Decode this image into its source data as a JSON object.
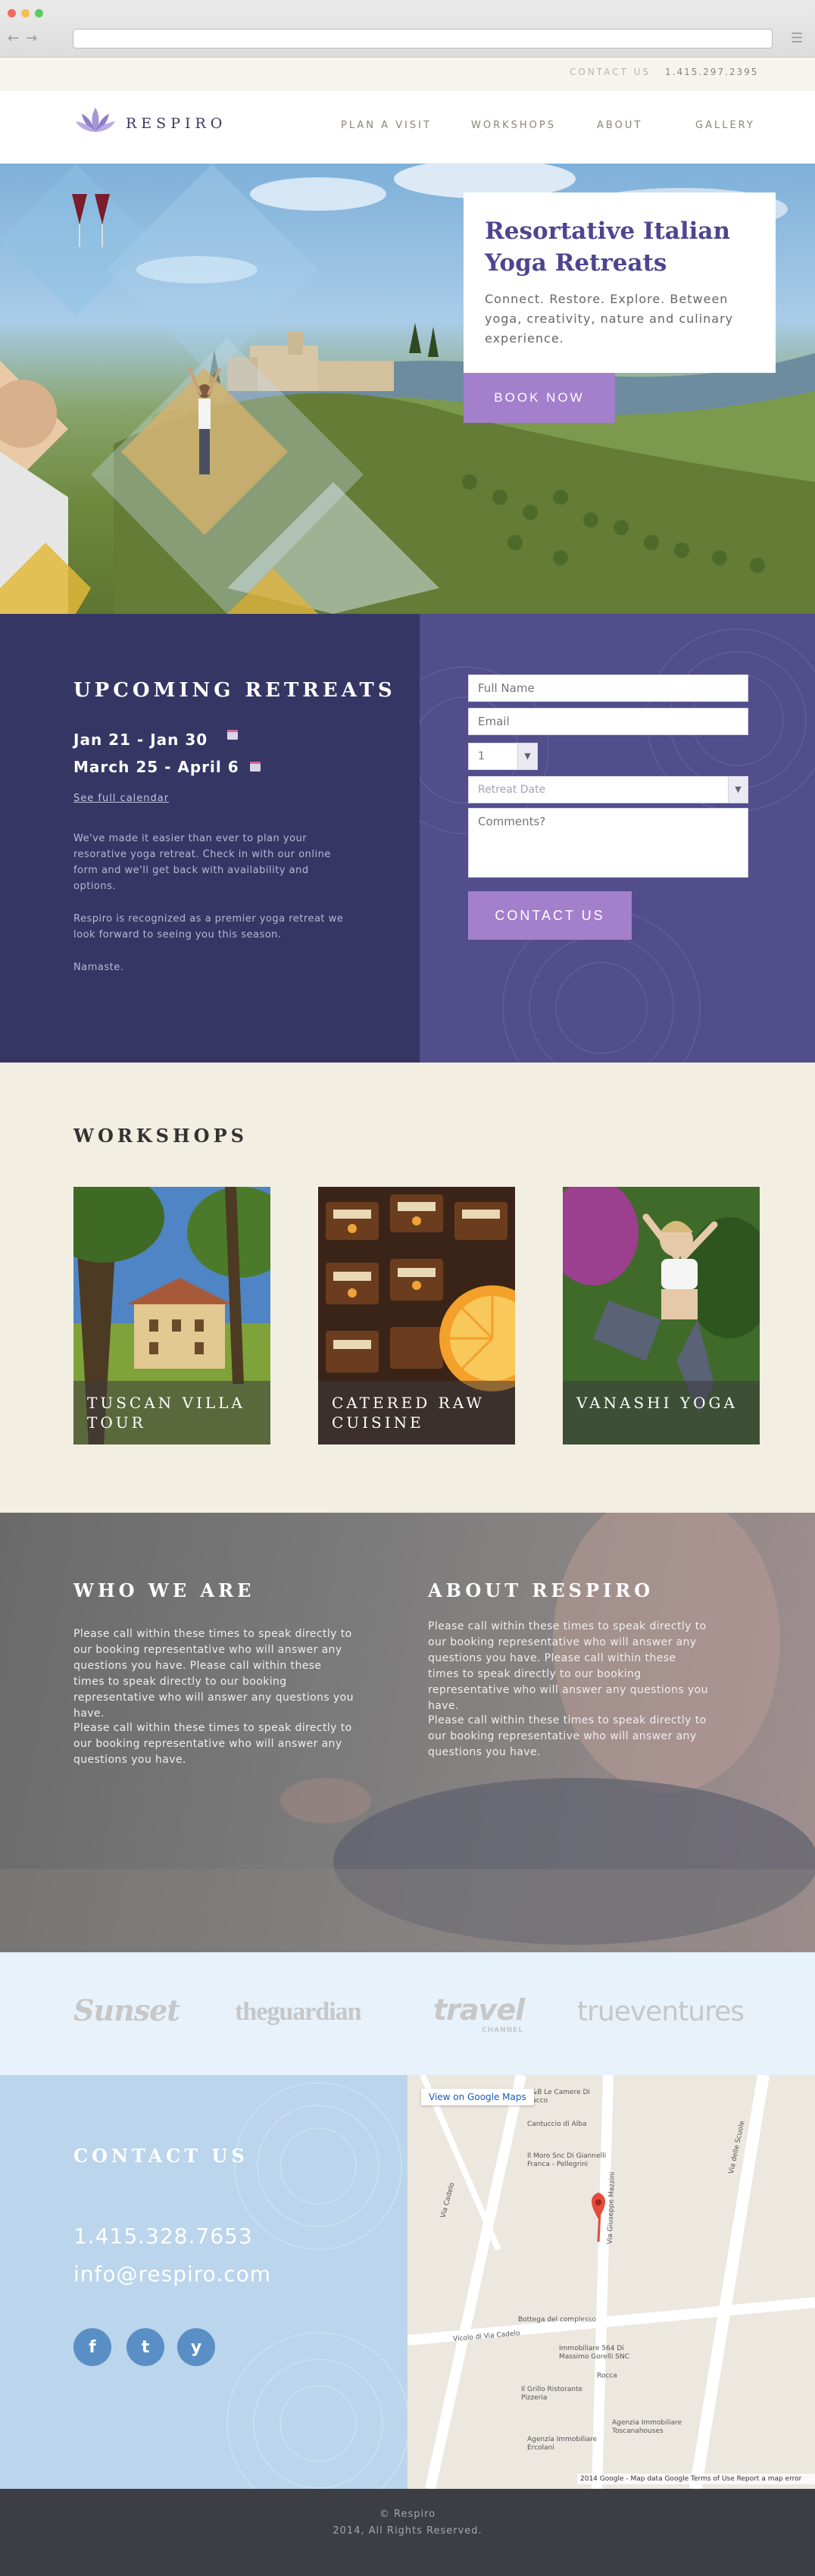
{
  "topbar": {
    "contact_label": "CONTACT US",
    "phone": "1.415.297.2395"
  },
  "header": {
    "logo": "RESPIRO",
    "nav": [
      "PLAN A VISIT",
      "WORKSHOPS",
      "ABOUT",
      "GALLERY"
    ]
  },
  "hero": {
    "title": "Resortative Italian Yoga Retreats",
    "subtitle": "Connect. Restore. Explore. Between yoga, creativity, nature and culinary experience.",
    "cta": "BOOK NOW"
  },
  "retreats": {
    "title": "UPCOMING RETREATS",
    "dates": [
      "Jan 21 - Jan 30",
      "March 25 - April 6"
    ],
    "calendar_link": "See full calendar",
    "para1": "We've made it easier than ever to plan your resorative yoga retreat. Check in with our online form and we'll get back with availability and options.",
    "para2": "Respiro is recognized as a premier yoga retreat we look forward to seeing you this season.",
    "para3": "Namaste.",
    "form": {
      "name_placeholder": "Full Name",
      "email_placeholder": "Email",
      "guests_value": "1",
      "date_placeholder": "Retreat Date",
      "comments_placeholder": "Comments?",
      "submit": "CONTACT US"
    }
  },
  "workshops": {
    "title": "WORKSHOPS",
    "items": [
      {
        "label": "TUSCAN VILLA TOUR"
      },
      {
        "label": "CATERED RAW CUISINE"
      },
      {
        "label": "VANASHI YOGA"
      }
    ]
  },
  "who": {
    "title": "WHO WE ARE",
    "para1": "Please call within these times to speak directly to our booking representative who will answer any questions you have. Please call within these times to speak directly to our booking representative who will answer any questions you have.",
    "para2": "Please call within these times to speak directly to our booking representative who will answer any questions you have."
  },
  "about": {
    "title": "ABOUT RESPIRO",
    "para1": "Please call within these times to speak directly to our booking representative who will answer any questions you have. Please call within these times to speak directly to our booking representative who will answer any questions you have.",
    "para2": "Please call within these times to speak directly to our booking representative who will answer any questions you have."
  },
  "press": [
    "Sunset",
    "theguardian",
    "travel",
    "CHANNEL",
    "trueventures"
  ],
  "contact": {
    "title": "CONTACT US",
    "phone": "1.415.328.7653",
    "email": "info@respiro.com",
    "social": [
      "f",
      "t",
      "y"
    ]
  },
  "map": {
    "link": "View on Google Maps",
    "labels": [
      "B&B Le Camere Di Bacco",
      "Cantuccio di Alba",
      "Il Moro Snc Di Giannelli Franca - Pellegrini",
      "Bottega del complesso",
      "Immobiliare 564 Di Massimo Gorelli SNC",
      "Rocca",
      "Il Grillo Ristorante Pizzeria",
      "Agenzia Immobiliare Toscanahouses",
      "Agenzia Immobiliare Ercolani",
      "Via Cadelo",
      "Via Giuseppe Mazzini",
      "Via delle Scuole",
      "Vicolo di Via Cadelo"
    ],
    "credit": "2014 Google - Map data Google Terms of Use Report a map error"
  },
  "footer": {
    "line1": "© Respiro",
    "line2": "2014, All Rights Reserved."
  },
  "colors": {
    "accent": "#a37fcc",
    "navy": "#363665",
    "purple": "#524d8b",
    "cream": "#f3eee2",
    "sky": "#bad5ec"
  }
}
